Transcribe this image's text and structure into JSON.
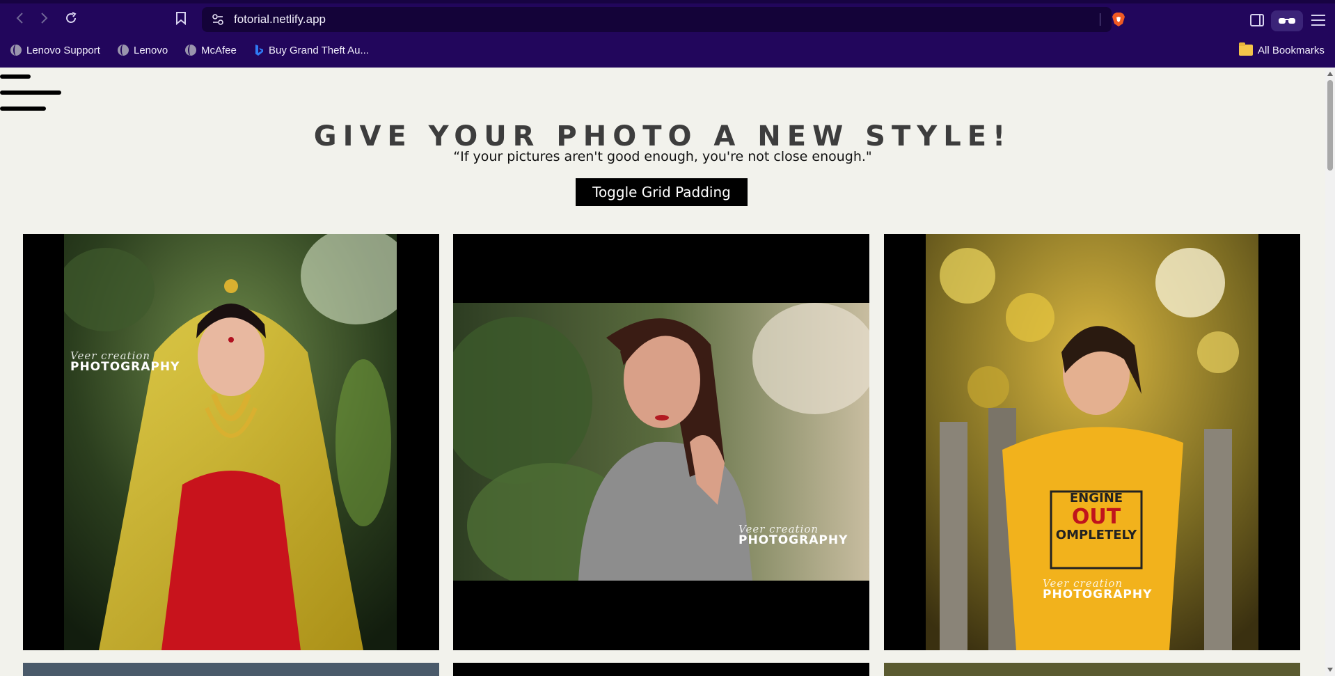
{
  "browser": {
    "url": "fotorial.netlify.app",
    "bookmarks": [
      {
        "label": "Lenovo Support",
        "icon": "globe-icon"
      },
      {
        "label": "Lenovo",
        "icon": "globe-icon"
      },
      {
        "label": "McAfee",
        "icon": "globe-icon"
      },
      {
        "label": "Buy Grand Theft Au...",
        "icon": "bing-icon"
      }
    ],
    "all_bookmarks_label": "All Bookmarks",
    "accent_color": "#22065c"
  },
  "page": {
    "title": "GIVE YOUR PHOTO A NEW STYLE!",
    "quote": "“If your pictures aren't good enough, you're not close enough.\"",
    "toggle_button_label": "Toggle Grid Padding",
    "photos": [
      {
        "watermark_script": "Veer creation",
        "watermark": "PHOTOGRAPHY"
      },
      {
        "watermark_script": "Veer creation",
        "watermark": "PHOTOGRAPHY"
      },
      {
        "watermark_script": "Veer creation",
        "watermark": "PHOTOGRAPHY",
        "shirt_text": [
          "ENGINE",
          "OUT",
          "OMPLETELY"
        ]
      }
    ]
  }
}
